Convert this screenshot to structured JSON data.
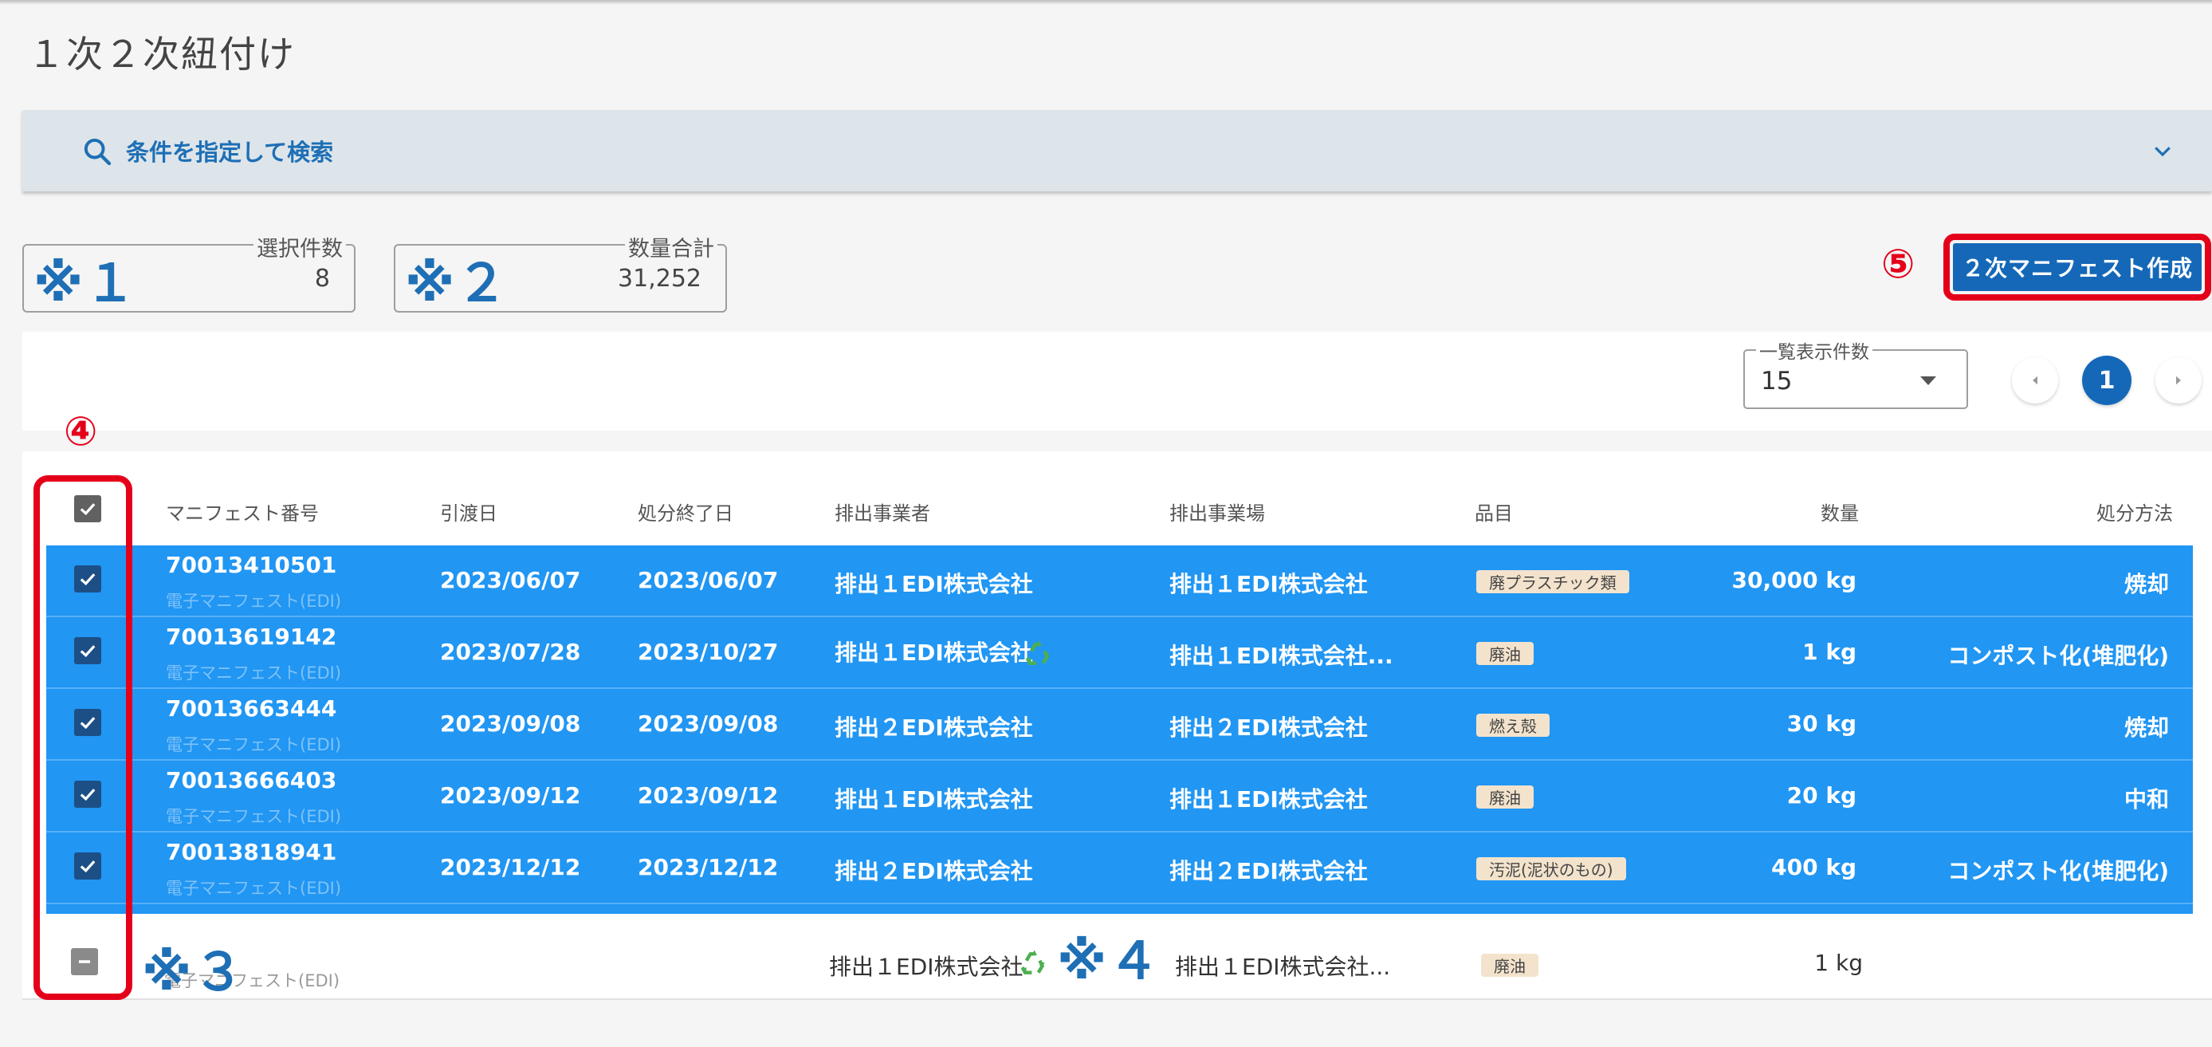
{
  "page": {
    "title": "１次２次紐付け"
  },
  "search": {
    "label": "条件を指定して検索"
  },
  "summary": {
    "count_label": "選択件数",
    "count_value": "8",
    "qty_label": "数量合計",
    "qty_value": "31,252"
  },
  "annotations": {
    "n1": "※１",
    "n2": "※２",
    "n3": "※３",
    "n4": "※４",
    "c4": "④",
    "c5": "⑤"
  },
  "actions": {
    "create_label": "２次マニフェスト作成"
  },
  "pagination": {
    "per_page_label": "一覧表示件数",
    "per_page_value": "15",
    "current_page": "1"
  },
  "table": {
    "columns": [
      "マニフェスト番号",
      "引渡日",
      "処分終了日",
      "排出事業者",
      "排出事業場",
      "品目",
      "数量",
      "処分方法"
    ],
    "rows": [
      {
        "no": "70013410501",
        "type": "電子マニフェスト(EDI)",
        "hand": "2023/06/07",
        "end": "2023/06/07",
        "emitter": "排出１EDI株式会社",
        "site": "排出１EDI株式会社",
        "item": "廃プラスチック類",
        "qty": "30,000 kg",
        "method": "焼却"
      },
      {
        "no": "70013619142",
        "type": "電子マニフェスト(EDI)",
        "hand": "2023/07/28",
        "end": "2023/10/27",
        "emitter": "排出１EDI株式会社",
        "site": "排出１EDI株式会社...",
        "item": "廃油",
        "qty": "1 kg",
        "method": "コンポスト化(堆肥化)"
      },
      {
        "no": "70013663444",
        "type": "電子マニフェスト(EDI)",
        "hand": "2023/09/08",
        "end": "2023/09/08",
        "emitter": "排出２EDI株式会社",
        "site": "排出２EDI株式会社",
        "item": "燃え殻",
        "qty": "30 kg",
        "method": "焼却"
      },
      {
        "no": "70013666403",
        "type": "電子マニフェスト(EDI)",
        "hand": "2023/09/12",
        "end": "2023/09/12",
        "emitter": "排出１EDI株式会社",
        "site": "排出１EDI株式会社",
        "item": "廃油",
        "qty": "20 kg",
        "method": "中和"
      },
      {
        "no": "70013818941",
        "type": "電子マニフェスト(EDI)",
        "hand": "2023/12/12",
        "end": "2023/12/12",
        "emitter": "排出２EDI株式会社",
        "site": "排出２EDI株式会社",
        "item": "汚泥(泥状のもの)",
        "qty": "400 kg",
        "method": "コンポスト化(堆肥化)"
      }
    ],
    "group_row": {
      "type": "電子マニフェスト(EDI)",
      "emitter": "排出１EDI株式会社",
      "site": "排出１EDI株式会社...",
      "item": "廃油",
      "qty": "1 kg"
    }
  },
  "colors": {
    "primary": "#1568b8",
    "selected_row": "#2196f3",
    "annotation_red": "#e5001a",
    "annotation_blue": "#1e6fb5",
    "chip": "#f3e3cc",
    "recycle": "#4caf50"
  },
  "icons": [
    "search-icon",
    "chevron-down-icon",
    "check-icon",
    "indeterminate-icon",
    "recycle-icon",
    "chevron-left-icon",
    "chevron-right-icon"
  ]
}
